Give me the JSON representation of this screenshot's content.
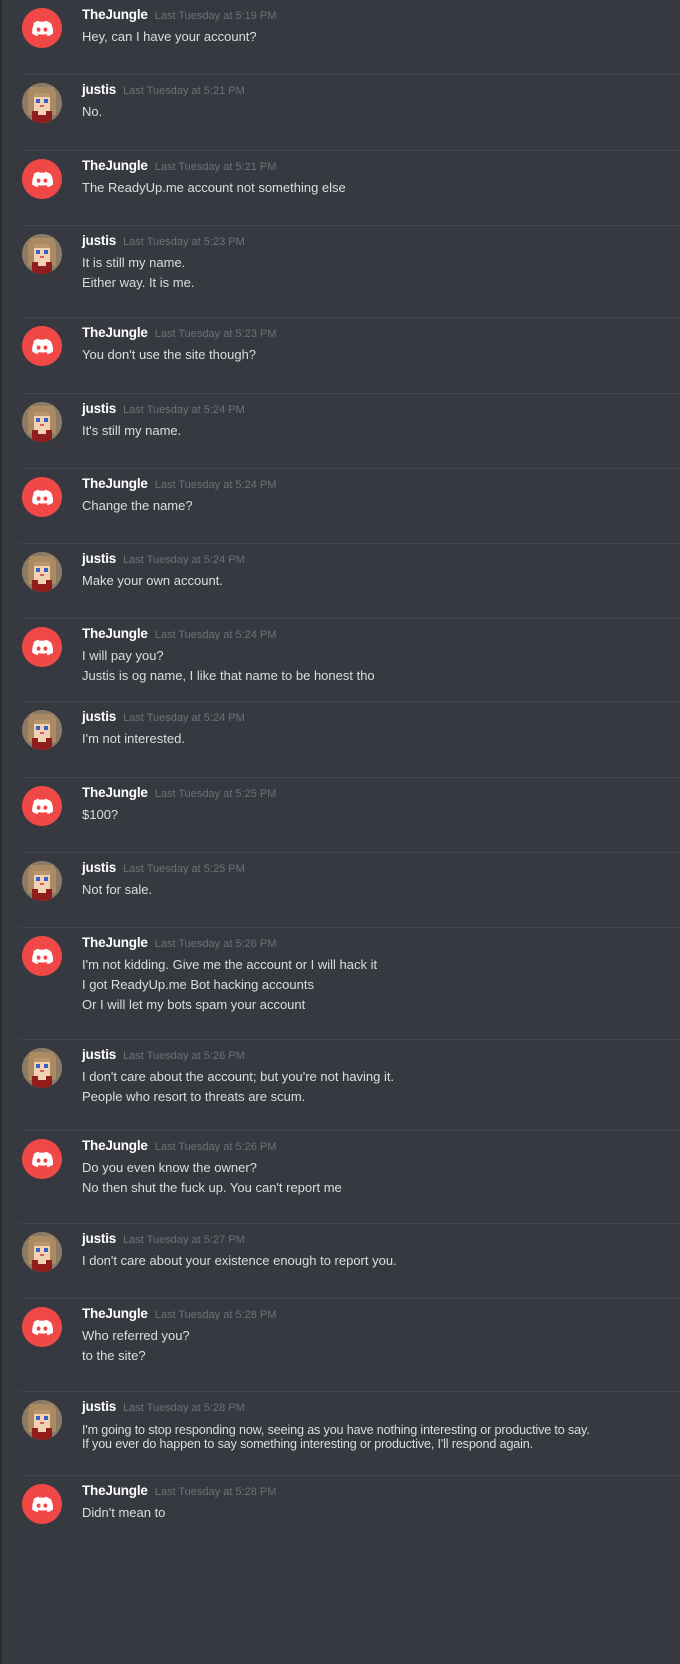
{
  "colors": {
    "background": "#36393f",
    "divider": "#40444b",
    "discord_red": "#f04747",
    "username": "#ffffff",
    "timestamp": "#6e7177",
    "text": "#dcddde"
  },
  "messages": [
    {
      "author": "TheJungle",
      "avatar": "discord-logo-icon",
      "time": "Last Tuesday at 5:19 PM",
      "lines": [
        "Hey, can I have your account?"
      ]
    },
    {
      "author": "justis",
      "avatar": "pixel-girl-avatar-icon",
      "time": "Last Tuesday at 5:21 PM",
      "lines": [
        "No."
      ]
    },
    {
      "author": "TheJungle",
      "avatar": "discord-logo-icon",
      "time": "Last Tuesday at 5:21 PM",
      "lines": [
        "The ReadyUp.me account not something else"
      ]
    },
    {
      "author": "justis",
      "avatar": "pixel-girl-avatar-icon",
      "time": "Last Tuesday at 5:23 PM",
      "lines": [
        "It is still my name.",
        "Either way. It is me."
      ]
    },
    {
      "author": "TheJungle",
      "avatar": "discord-logo-icon",
      "time": "Last Tuesday at 5:23 PM",
      "lines": [
        "You don't use the site though?"
      ]
    },
    {
      "author": "justis",
      "avatar": "pixel-girl-avatar-icon",
      "time": "Last Tuesday at 5:24 PM",
      "lines": [
        "It's still my name."
      ]
    },
    {
      "author": "TheJungle",
      "avatar": "discord-logo-icon",
      "time": "Last Tuesday at 5:24 PM",
      "lines": [
        "Change the name?"
      ]
    },
    {
      "author": "justis",
      "avatar": "pixel-girl-avatar-icon",
      "time": "Last Tuesday at 5:24 PM",
      "lines": [
        "Make your own account."
      ]
    },
    {
      "author": "TheJungle",
      "avatar": "discord-logo-icon",
      "time": "Last Tuesday at 5:24 PM",
      "lines": [
        "I will pay you?",
        "Justis is og name, I like that name to be honest tho"
      ]
    },
    {
      "author": "justis",
      "avatar": "pixel-girl-avatar-icon",
      "time": "Last Tuesday at 5:24 PM",
      "lines": [
        "I'm not interested."
      ]
    },
    {
      "author": "TheJungle",
      "avatar": "discord-logo-icon",
      "time": "Last Tuesday at 5:25 PM",
      "lines": [
        "$100?"
      ]
    },
    {
      "author": "justis",
      "avatar": "pixel-girl-avatar-icon",
      "time": "Last Tuesday at 5:25 PM",
      "lines": [
        "Not for sale."
      ]
    },
    {
      "author": "TheJungle",
      "avatar": "discord-logo-icon",
      "time": "Last Tuesday at 5:26 PM",
      "lines": [
        "I'm not kidding. Give me the account or I will hack it",
        "I got ReadyUp.me Bot hacking accounts",
        "Or I will let my bots spam your account"
      ]
    },
    {
      "author": "justis",
      "avatar": "pixel-girl-avatar-icon",
      "time": "Last Tuesday at 5:26 PM",
      "lines": [
        "I don't care about the account; but you're not having it.",
        "People who resort to threats are scum."
      ]
    },
    {
      "author": "TheJungle",
      "avatar": "discord-logo-icon",
      "time": "Last Tuesday at 5:26 PM",
      "lines": [
        "Do you even know the owner?",
        "No then shut the fuck up. You can't report me"
      ]
    },
    {
      "author": "justis",
      "avatar": "pixel-girl-avatar-icon",
      "time": "Last Tuesday at 5:27 PM",
      "lines": [
        "I don't care about your existence enough to report you."
      ]
    },
    {
      "author": "TheJungle",
      "avatar": "discord-logo-icon",
      "time": "Last Tuesday at 5:28 PM",
      "lines": [
        "Who referred you?",
        "to the site?"
      ]
    },
    {
      "author": "justis",
      "avatar": "pixel-girl-avatar-icon",
      "time": "Last Tuesday at 5:28 PM",
      "lines": [
        "I'm going to stop responding now, seeing as you have nothing interesting or productive to say.",
        "If you ever do happen to say something interesting or productive, I'll respond again."
      ],
      "compact": true
    },
    {
      "author": "TheJungle",
      "avatar": "discord-logo-icon",
      "time": "Last Tuesday at 5:28 PM",
      "lines": [
        "Didn't mean to"
      ]
    }
  ]
}
